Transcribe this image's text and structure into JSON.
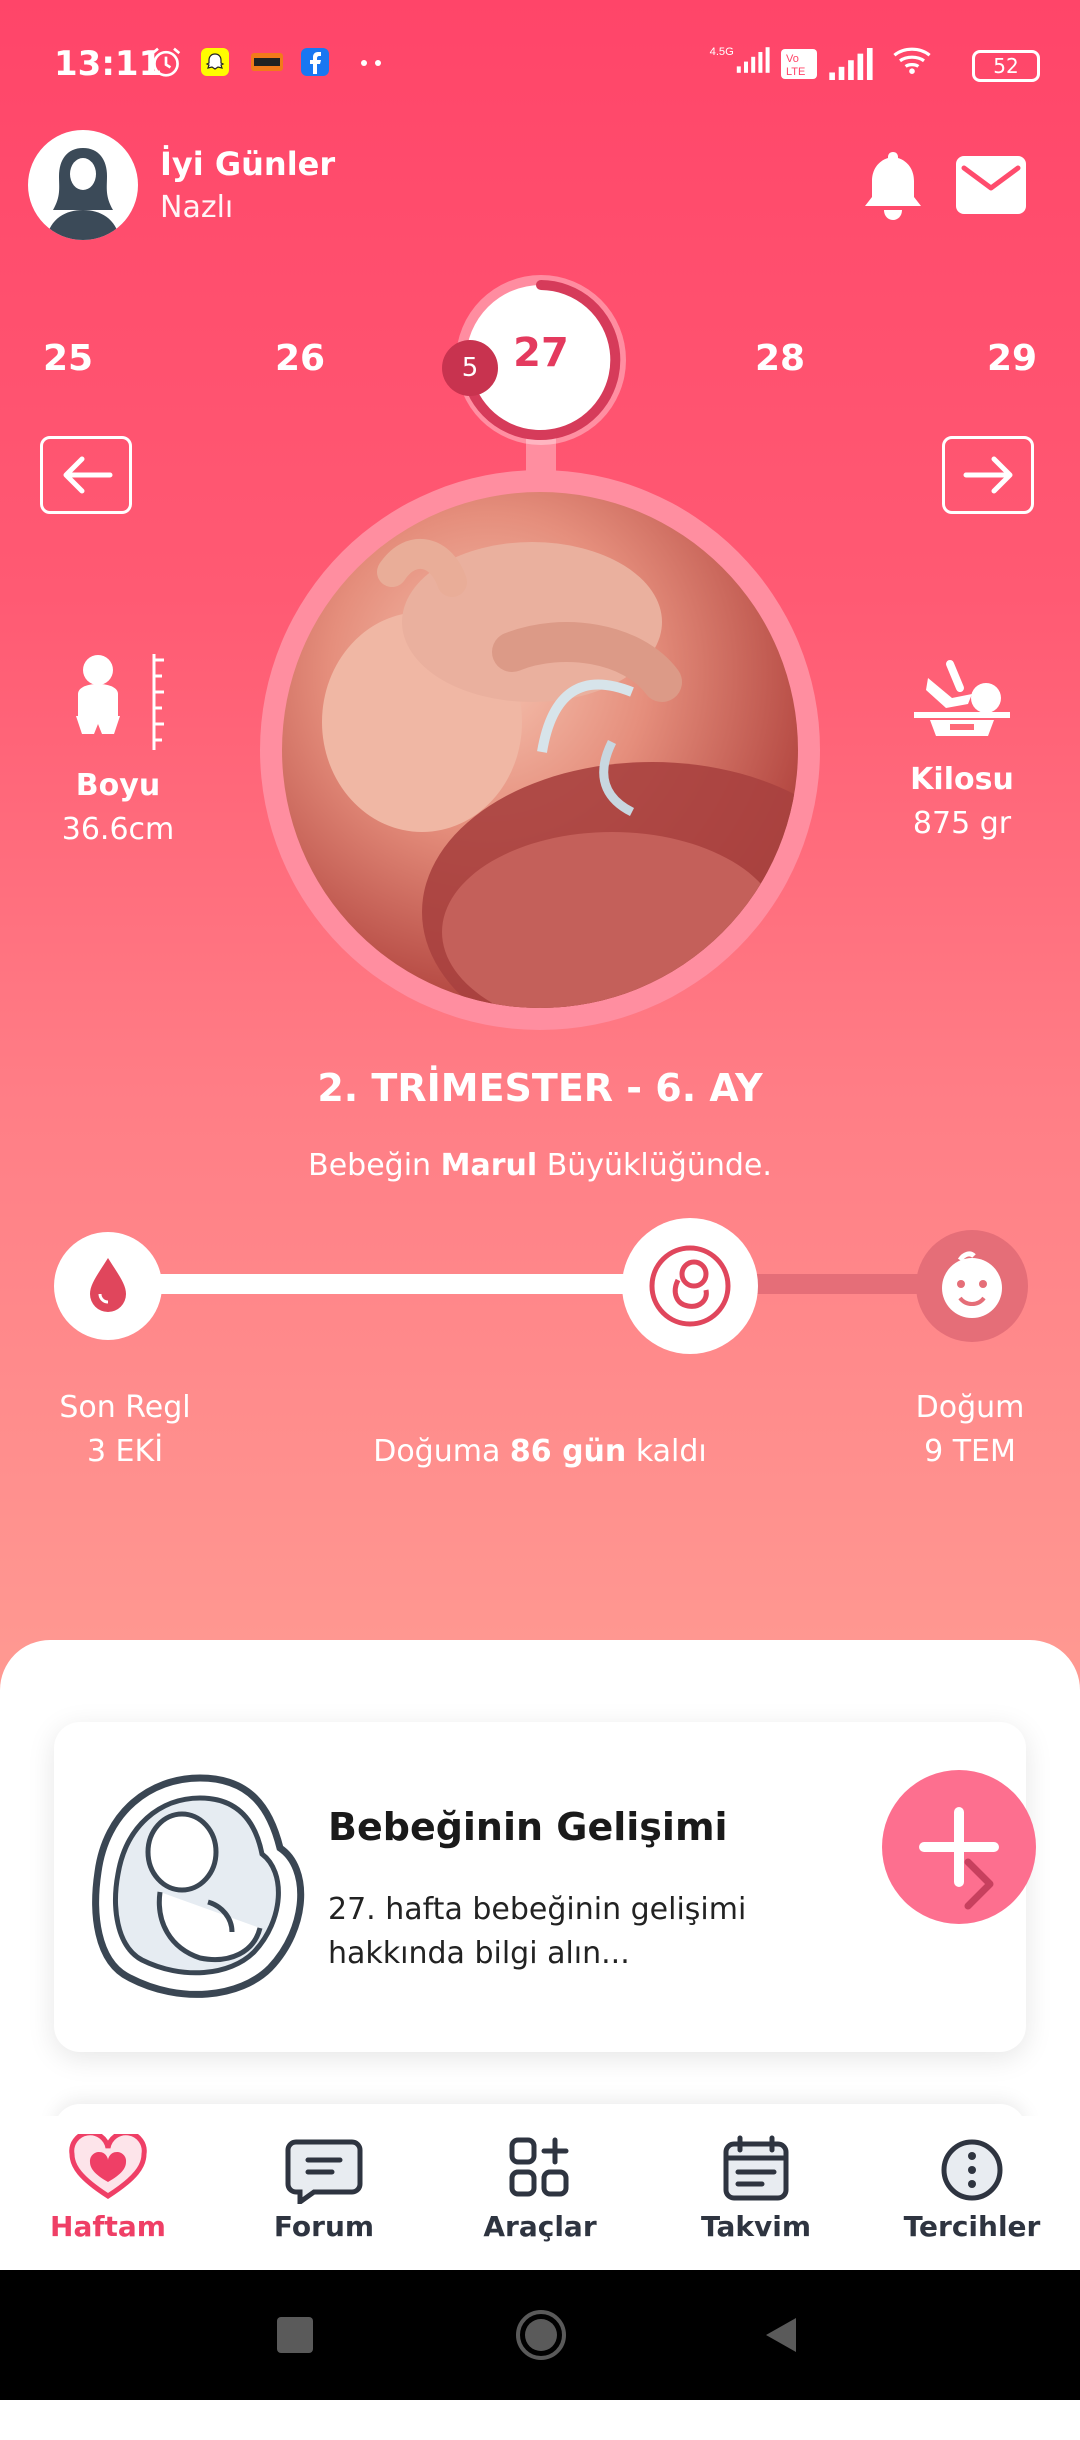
{
  "status_bar": {
    "time": "13:11",
    "network": "4.5G",
    "battery": "52"
  },
  "header": {
    "greeting": "İyi Günler",
    "user_name": "Nazlı"
  },
  "weeks": {
    "items": [
      "25",
      "26",
      "27",
      "28",
      "29"
    ],
    "current": "27",
    "current_day_badge": "5"
  },
  "metrics": {
    "length_label": "Boyu",
    "length_value": "36.6cm",
    "weight_label": "Kilosu",
    "weight_value": "875 gr"
  },
  "trimester": "2. TRİMESTER - 6. AY",
  "size": {
    "prefix": "Bebeğin",
    "fruit": "Marul",
    "suffix": "Büyüklüğünde."
  },
  "progress": {
    "fraction": 0.63,
    "start_label": "Son Regl",
    "start_date": "3 EKİ",
    "end_label": "Doğum",
    "end_date": "9 TEM",
    "countdown_prefix": "Doğuma",
    "countdown_value": "86 gün",
    "countdown_suffix": "kaldı"
  },
  "card": {
    "title": "Bebeğinin Gelişimi",
    "description": "27. hafta bebeğinin gelişimi hakkında bilgi alın..."
  },
  "bottom_nav": [
    {
      "label": "Haftam",
      "icon": "heart-icon"
    },
    {
      "label": "Forum",
      "icon": "chat-icon"
    },
    {
      "label": "Araçlar",
      "icon": "tools-icon"
    },
    {
      "label": "Takvim",
      "icon": "calendar-icon"
    },
    {
      "label": "Tercihler",
      "icon": "more-icon"
    }
  ],
  "colors": {
    "accent": "#ef3f66",
    "hero_top": "#ff4569",
    "hero_bottom": "#ff9a92",
    "fab": "#fd6f8f"
  }
}
